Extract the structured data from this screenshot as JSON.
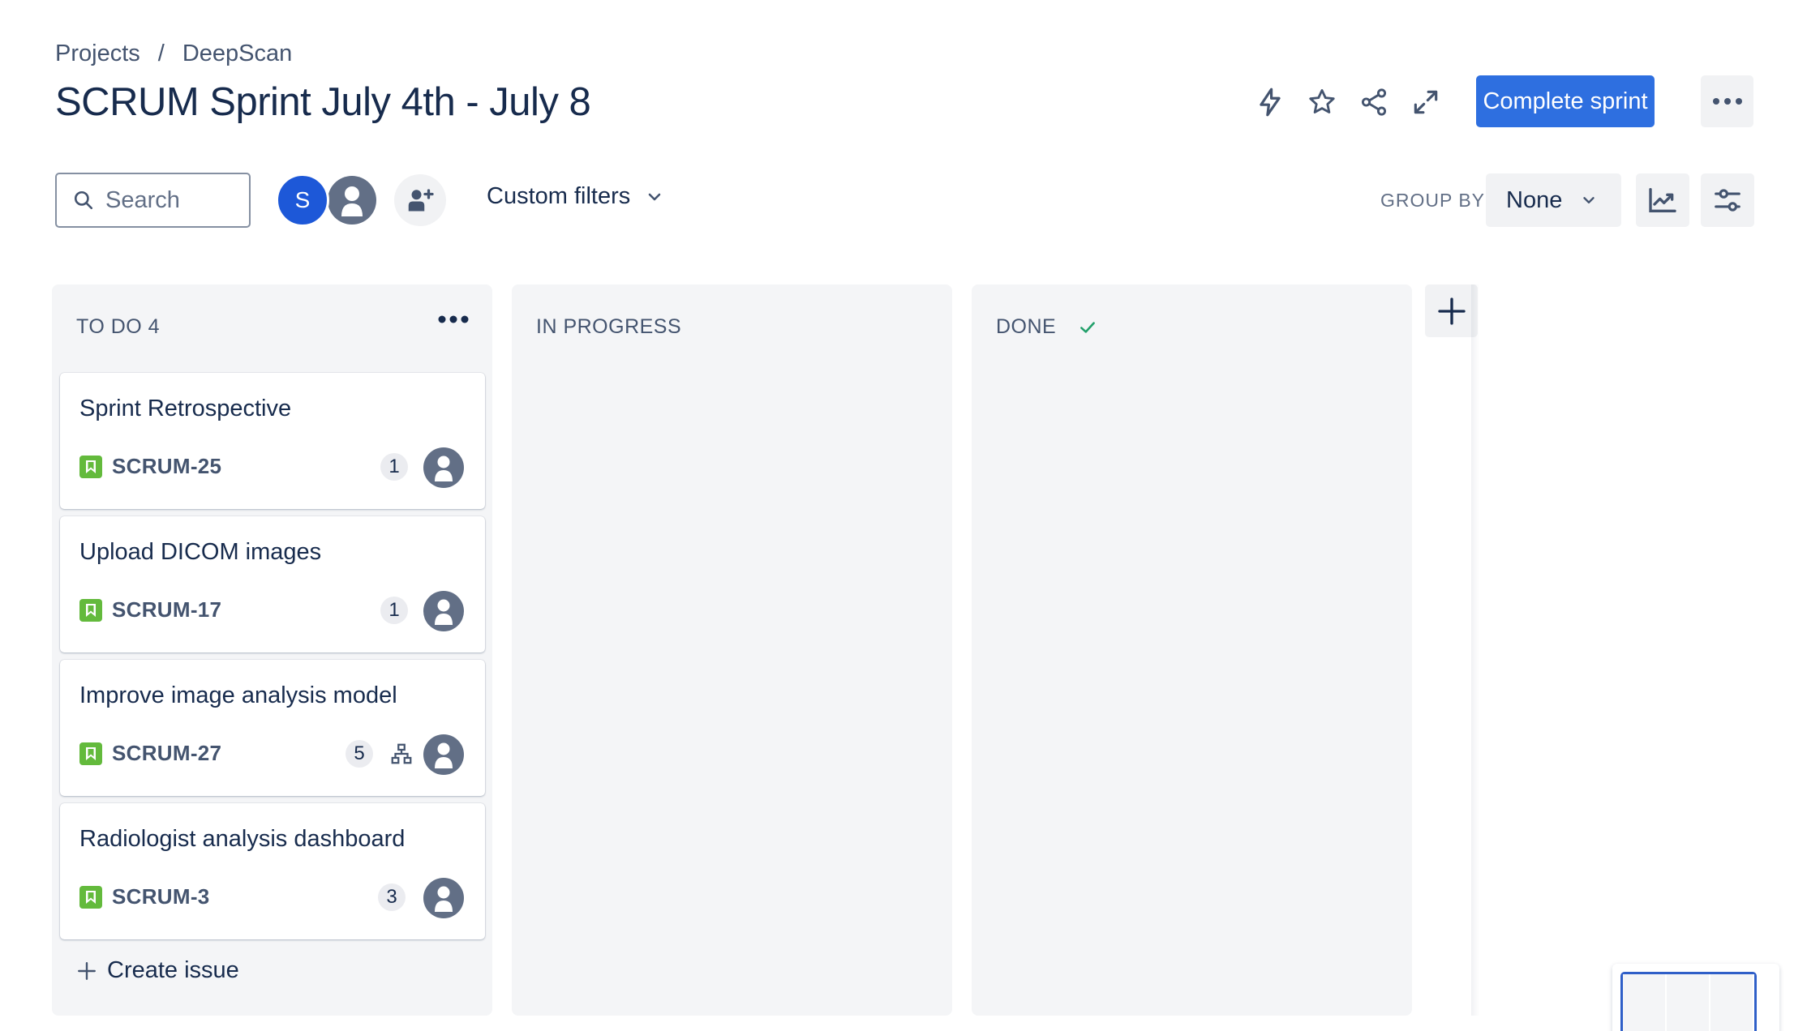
{
  "breadcrumb": {
    "items": [
      "Projects",
      "DeepScan"
    ],
    "separator": "/"
  },
  "page_title": "SCRUM Sprint July 4th - July 8",
  "header_actions": {
    "icons": [
      "lightning-icon",
      "star-icon",
      "share-icon",
      "expand-icon"
    ],
    "complete_sprint_label": "Complete sprint",
    "more_icon": "more-horizontal-icon"
  },
  "toolbar": {
    "search_placeholder": "Search",
    "avatar_initial": "S",
    "custom_filters_label": "Custom filters",
    "group_by_label": "GROUP BY",
    "group_by_value": "None"
  },
  "columns": [
    {
      "title": "TO DO 4",
      "show_check": false
    },
    {
      "title": "IN PROGRESS",
      "show_check": false
    },
    {
      "title": "DONE",
      "show_check": true
    }
  ],
  "cards": [
    {
      "title": "Sprint Retrospective",
      "key": "SCRUM-25",
      "estimate": "1",
      "has_child_icon": false
    },
    {
      "title": "Upload DICOM images",
      "key": "SCRUM-17",
      "estimate": "1",
      "has_child_icon": false
    },
    {
      "title": "Improve image analysis model",
      "key": "SCRUM-27",
      "estimate": "5",
      "has_child_icon": true
    },
    {
      "title": "Radiologist analysis dashboard",
      "key": "SCRUM-3",
      "estimate": "3",
      "has_child_icon": false
    }
  ],
  "create_issue_label": "Create issue",
  "colors": {
    "primary": "#2e6fe0",
    "story": "#63ba3c",
    "column_bg": "#f4f5f7",
    "done_check": "#22a06b"
  }
}
